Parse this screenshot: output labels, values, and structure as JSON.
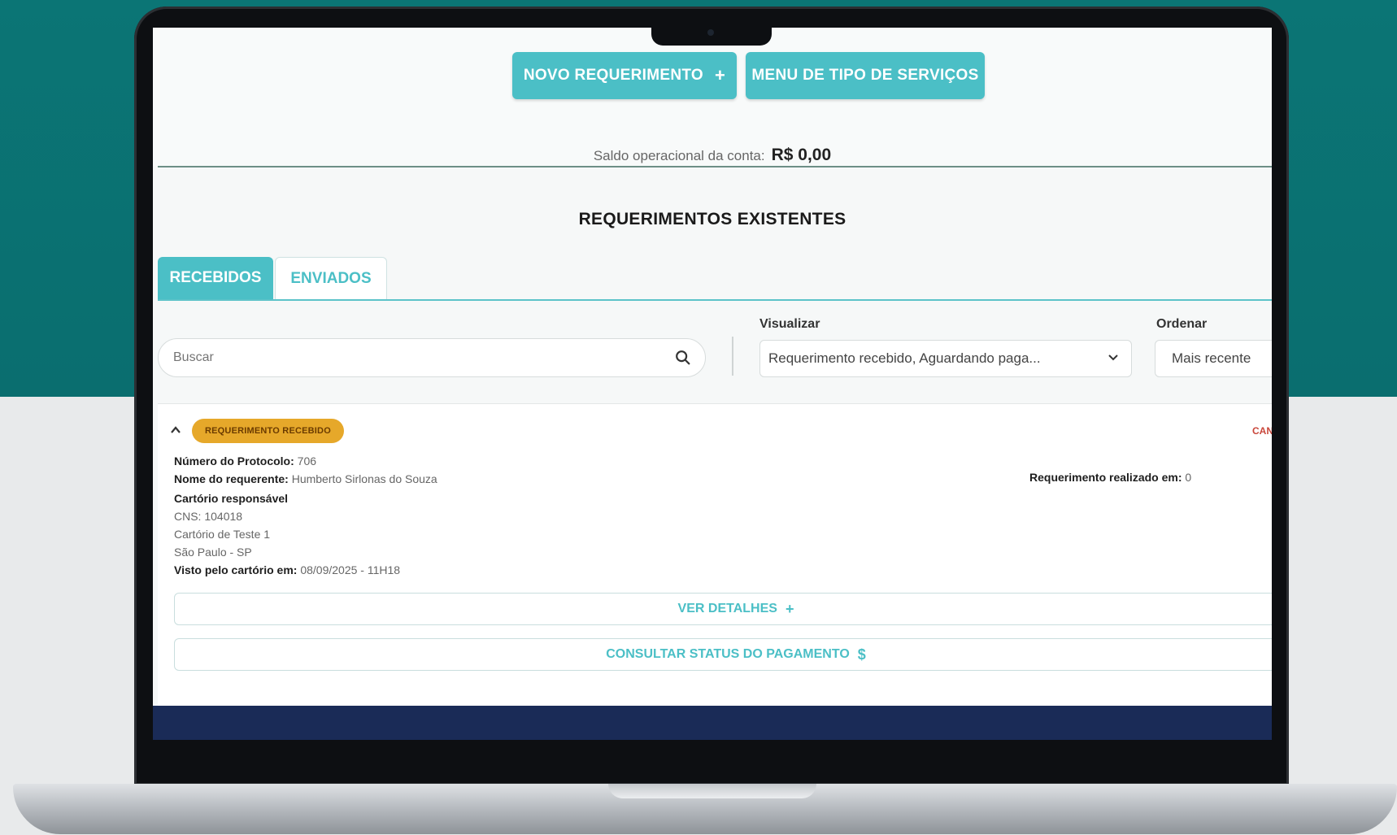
{
  "header": {
    "novo_requerimento_label": "NOVO REQUERIMENTO",
    "novo_requerimento_icon": "+",
    "menu_tipo_servicos_label": "MENU DE TIPO DE SERVIÇOS"
  },
  "account": {
    "saldo_label": "Saldo operacional da conta:",
    "saldo_value": "R$ 0,00"
  },
  "section": {
    "title": "REQUERIMENTOS EXISTENTES",
    "tabs": [
      {
        "label": "RECEBIDOS",
        "active": true
      },
      {
        "label": "ENVIADOS",
        "active": false
      }
    ]
  },
  "filters": {
    "search_placeholder": "Buscar",
    "visualizar_label": "Visualizar",
    "visualizar_value": "Requerimento recebido, Aguardando paga...",
    "ordenar_label": "Ordenar",
    "ordenar_value": "Mais recente"
  },
  "card": {
    "status_badge": "REQUERIMENTO RECEBIDO",
    "cancel_label": "CAN",
    "protocolo_label": "Número do Protocolo:",
    "protocolo_value": "706",
    "requerente_label": "Nome do requerente:",
    "requerente_value": "Humberto Sirlonas do Souza",
    "realizado_label": "Requerimento realizado em:",
    "realizado_value": "0",
    "cartorio_heading": "Cartório responsável",
    "cns": "CNS: 104018",
    "cartorio_nome": "Cartório de Teste 1",
    "cidade": "São Paulo - SP",
    "visto_label": "Visto pelo cartório em:",
    "visto_value": "08/09/2025 - 11H18",
    "ver_detalhes_label": "VER DETALHES",
    "ver_detalhes_icon": "+",
    "consultar_label": "CONSULTAR STATUS DO PAGAMENTO",
    "consultar_icon": "$"
  },
  "colors": {
    "accent": "#4bbfc6",
    "badge": "#e6a82a",
    "teal_bg": "#0b7575",
    "footer": "#1a2b57"
  }
}
